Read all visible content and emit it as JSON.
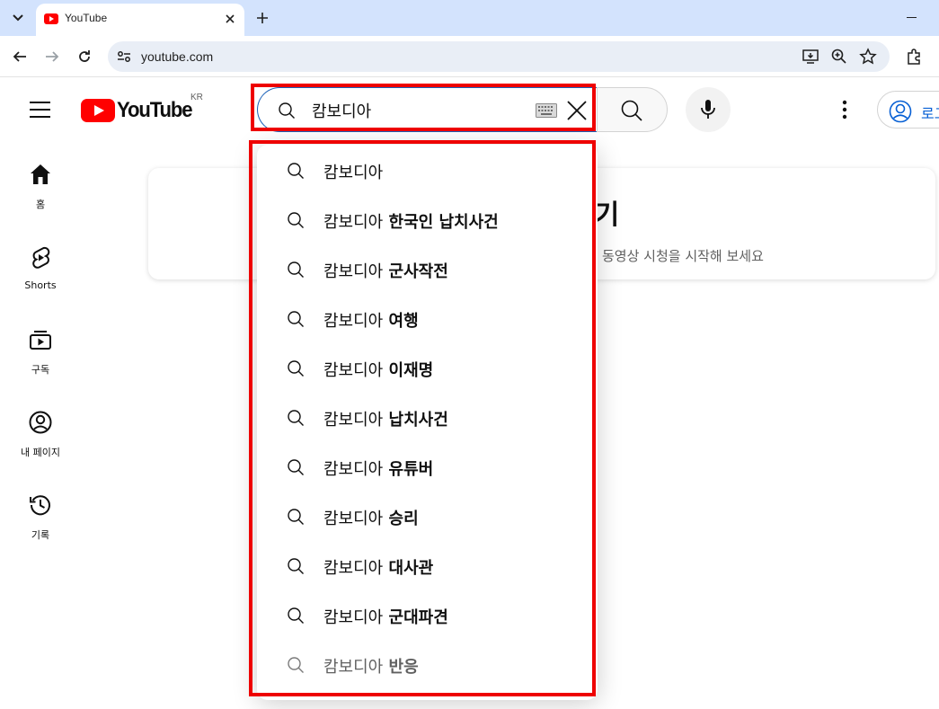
{
  "browser": {
    "tab_title": "YouTube",
    "url": "youtube.com",
    "icons": [
      "tab-list-icon",
      "youtube-favicon",
      "close-icon",
      "plus-icon",
      "minimize-icon",
      "back-icon",
      "forward-icon",
      "reload-icon",
      "site-settings-icon",
      "install-app-icon",
      "zoom-icon",
      "bookmark-star-icon",
      "extensions-icon"
    ]
  },
  "header": {
    "logo_text": "YouTube",
    "country_code": "KR",
    "search": {
      "value": "캄보디아",
      "icons": [
        "search-icon",
        "keyboard-icon",
        "clear-icon"
      ]
    },
    "signin_label": "로그인"
  },
  "guide": {
    "items": [
      {
        "label": "홈",
        "icon": "home-icon"
      },
      {
        "label": "Shorts",
        "icon": "shorts-icon"
      },
      {
        "label": "구독",
        "icon": "subscriptions-icon"
      },
      {
        "label": "내 페이지",
        "icon": "account-icon"
      },
      {
        "label": "기록",
        "icon": "history-icon"
      }
    ]
  },
  "feed_prompt": {
    "title_visible": "하기",
    "subtitle_visible": "동영상 시청을 시작해 보세요"
  },
  "suggestions": [
    {
      "prefix": "캄보디아",
      "rest": ""
    },
    {
      "prefix": "캄보디아",
      "rest": " 한국인 납치사건"
    },
    {
      "prefix": "캄보디아",
      "rest": " 군사작전"
    },
    {
      "prefix": "캄보디아",
      "rest": " 여행"
    },
    {
      "prefix": "캄보디아",
      "rest": " 이재명"
    },
    {
      "prefix": "캄보디아",
      "rest": " 납치사건"
    },
    {
      "prefix": "캄보디아",
      "rest": " 유튜버"
    },
    {
      "prefix": "캄보디아",
      "rest": " 승리"
    },
    {
      "prefix": "캄보디아",
      "rest": " 대사관"
    },
    {
      "prefix": "캄보디아",
      "rest": " 군대파견"
    },
    {
      "prefix": "캄보디아",
      "rest": " 반응"
    }
  ],
  "colors": {
    "accent_blue": "#065fd4",
    "youtube_red": "#ff0000",
    "highlight_red": "#ee0000",
    "tabstrip": "#d3e3fd"
  }
}
